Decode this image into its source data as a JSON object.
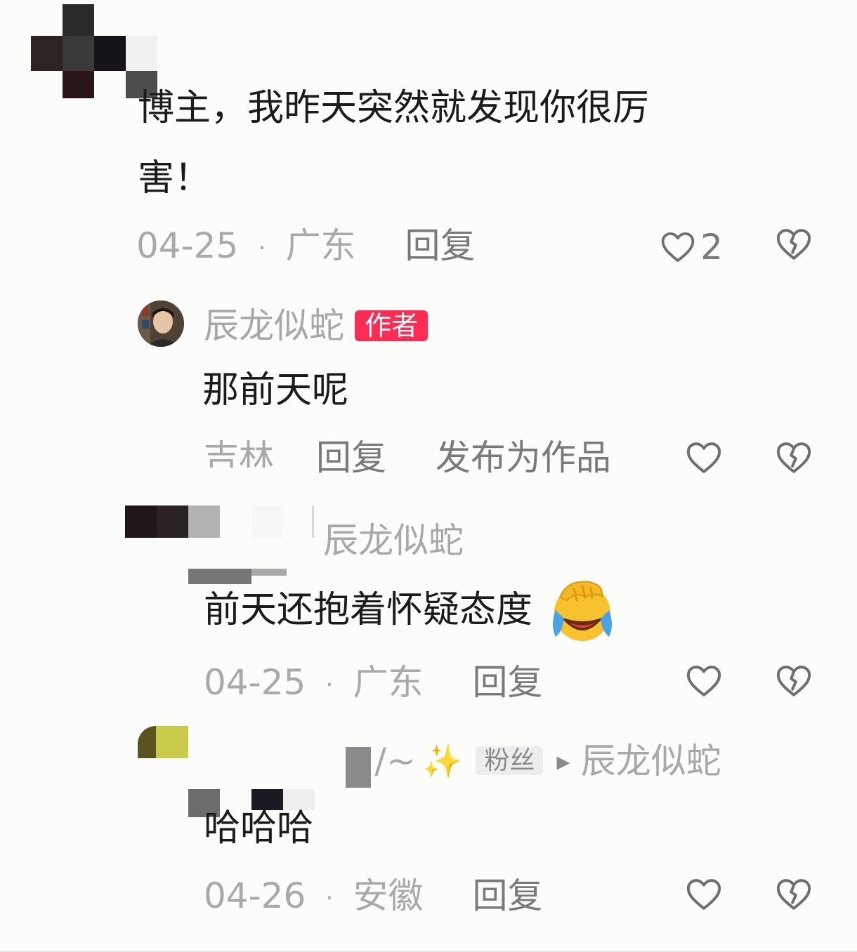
{
  "comments": [
    {
      "text_line1": "博主，我昨天突然就发现你很厉",
      "text_line2": "害！",
      "date": "04-25",
      "dot": "·",
      "location": "广东",
      "reply_label": "回复",
      "like_count": "2"
    }
  ],
  "replies": [
    {
      "username": "辰龙似蛇",
      "badge": "作者",
      "text": "那前天呢",
      "location": "吉林",
      "reply_label": "回复",
      "publish_label": "发布为作品"
    },
    {
      "reply_to": "辰龙似蛇",
      "text": "前天还抱着怀疑态度",
      "date": "04-25",
      "dot": "·",
      "location": "广东",
      "reply_label": "回复"
    },
    {
      "username_suffix": "/~",
      "sparkle": "✨",
      "badge": "粉丝",
      "arrow": "▸",
      "reply_to": "辰龙似蛇",
      "text": "哈哈哈",
      "date": "04-26",
      "dot": "·",
      "location": "安徽",
      "reply_label": "回复"
    }
  ],
  "icons": {
    "like": "heart-outline-icon",
    "dislike": "broken-heart-icon",
    "emoji": "face-palm-laugh-emoji"
  },
  "colors": {
    "author_badge": "#fe2c55",
    "text": "#1b1b1b",
    "meta": "#a9a9a9"
  }
}
